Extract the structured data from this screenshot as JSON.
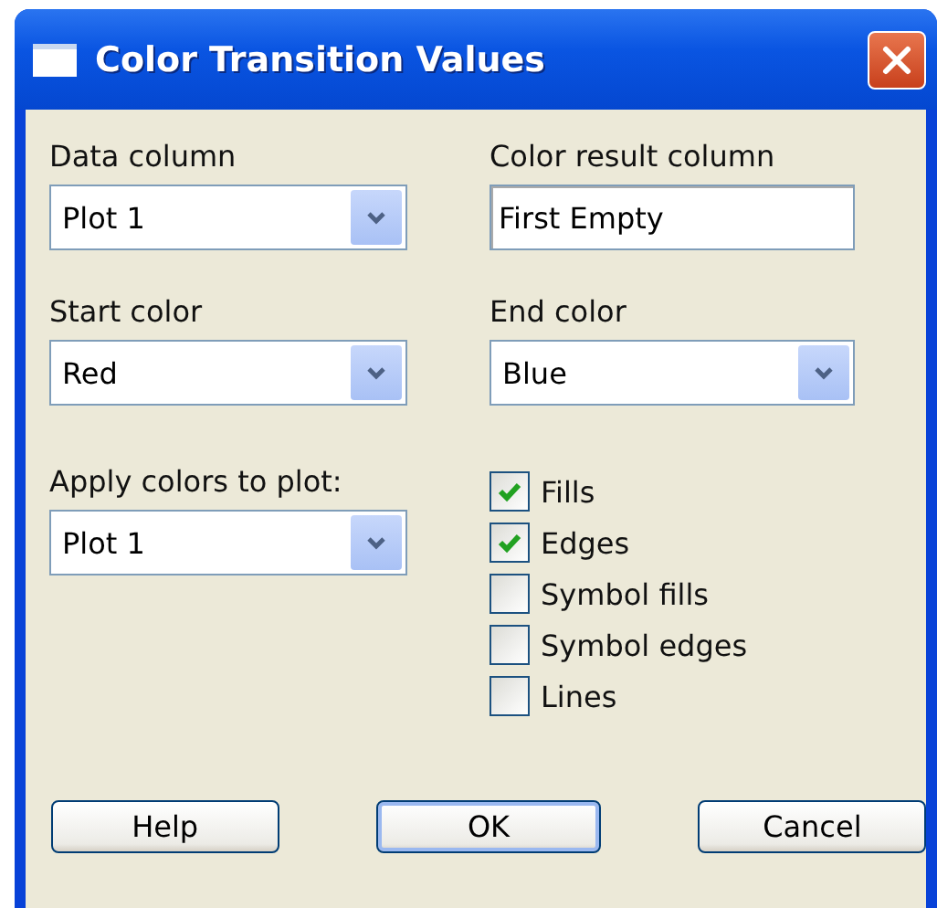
{
  "window": {
    "title": "Color Transition Values"
  },
  "data_column": {
    "label": "Data column",
    "value": "Plot 1"
  },
  "color_result_column": {
    "label": "Color result column",
    "value": "First Empty"
  },
  "start_color": {
    "label": "Start color",
    "value": "Red"
  },
  "end_color": {
    "label": "End color",
    "value": "Blue"
  },
  "apply_to_plot": {
    "label": "Apply colors to plot:",
    "value": "Plot 1"
  },
  "options": [
    {
      "label": "Fills",
      "checked": true
    },
    {
      "label": "Edges",
      "checked": true
    },
    {
      "label": "Symbol fills",
      "checked": false
    },
    {
      "label": "Symbol edges",
      "checked": false
    },
    {
      "label": "Lines",
      "checked": false
    }
  ],
  "buttons": [
    {
      "label": "Help",
      "default": false
    },
    {
      "label": "OK",
      "default": true
    },
    {
      "label": "Cancel",
      "default": false
    }
  ]
}
